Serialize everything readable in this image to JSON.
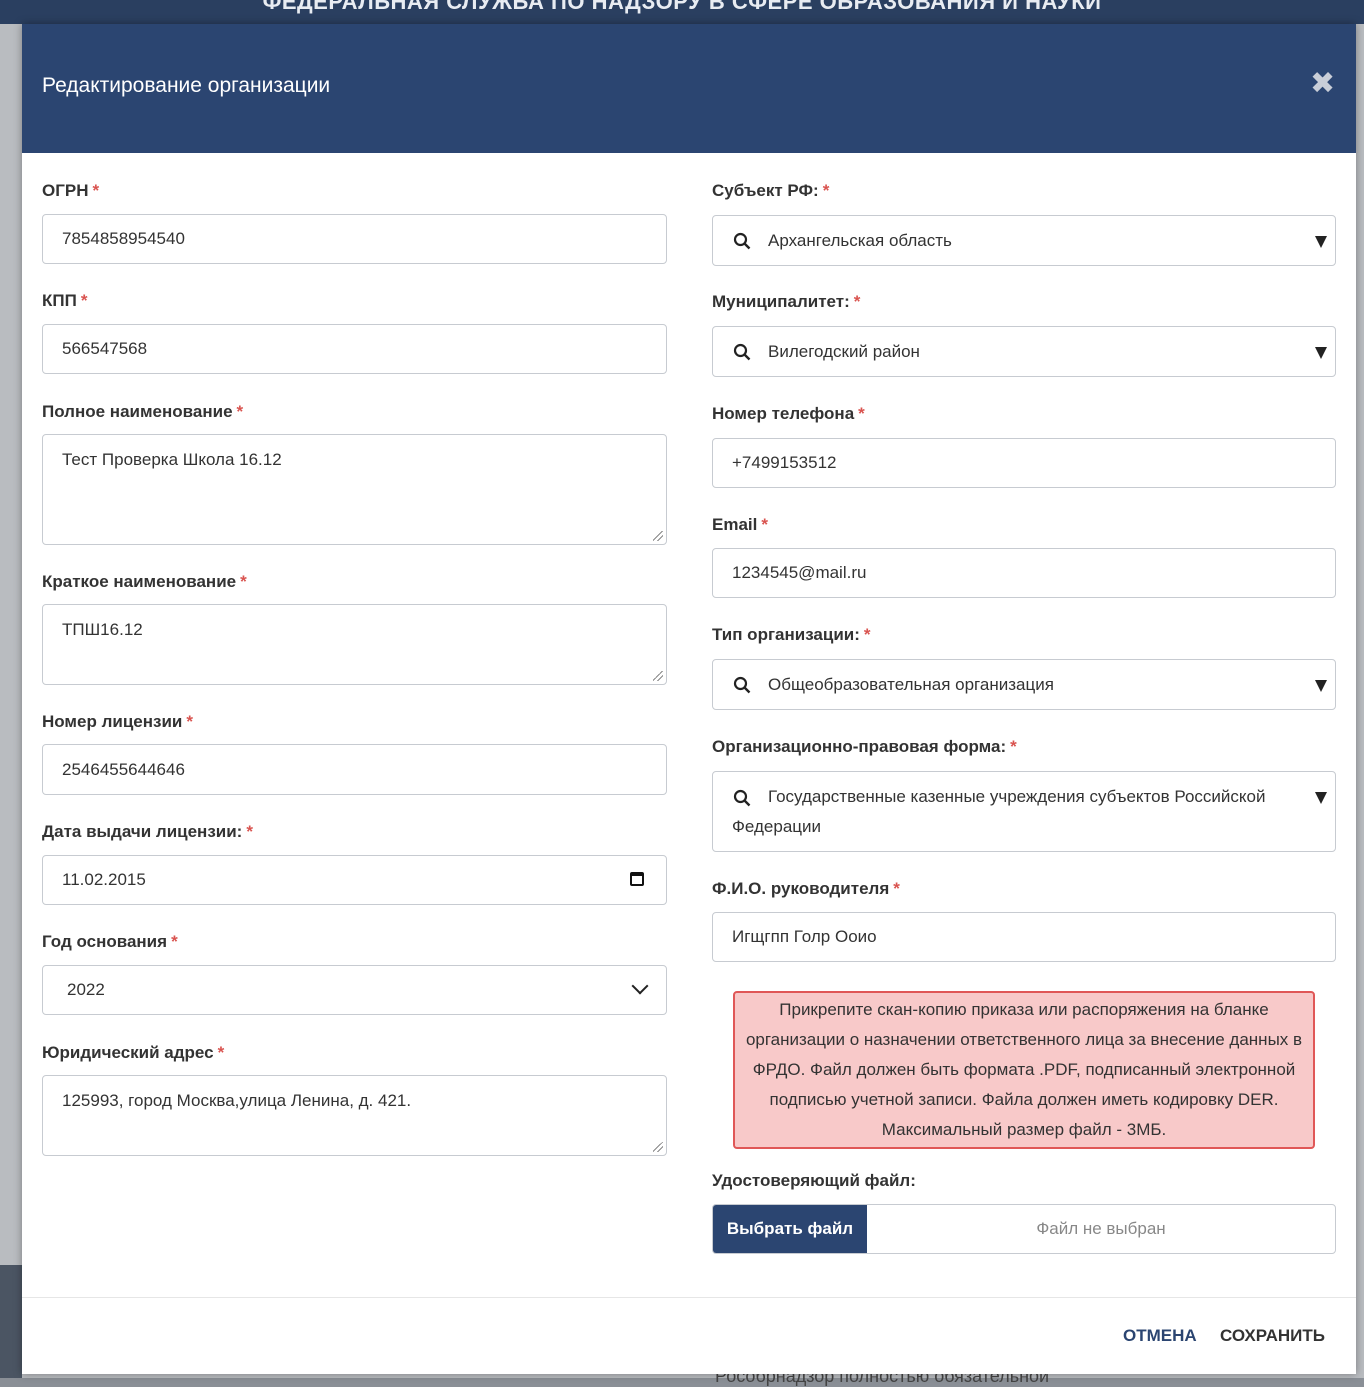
{
  "backdrop": {
    "header_text": "ФЕДЕРАЛЬНАЯ СЛУЖБА ПО НАДЗОРУ В СФЕРЕ ОБРАЗОВАНИЯ И НАУКИ",
    "bottom_text": "Рособрнадзор полностью обязательной"
  },
  "modal": {
    "title": "Редактирование организации",
    "close_icon": "close-icon"
  },
  "form": {
    "ogrn": {
      "label": "ОГРН",
      "value": "7854858954540"
    },
    "kpp": {
      "label": "КПП",
      "value": "566547568"
    },
    "full_name": {
      "label": "Полное наименование",
      "value": "Тест Проверка Школа 16.12"
    },
    "short_name": {
      "label": "Краткое наименование",
      "value": "ТПШ16.12"
    },
    "license_number": {
      "label": "Номер лицензии",
      "value": "2546455644646"
    },
    "license_date": {
      "label": "Дата выдачи лицензии:",
      "value": "11.02.2015"
    },
    "founding_year": {
      "label": "Год основания",
      "value": "2022"
    },
    "legal_address": {
      "label": "Юридический адрес",
      "value": "125993, город Москва,улица Ленина, д. 421."
    },
    "region": {
      "label": "Субъект РФ:",
      "value": "Архангельская область"
    },
    "municipality": {
      "label": "Муниципалитет:",
      "value": "Вилегодский район"
    },
    "phone": {
      "label": "Номер телефона",
      "value": "+7499153512"
    },
    "email": {
      "label": "Email",
      "value": "1234545@mail.ru"
    },
    "org_type": {
      "label": "Тип организации:",
      "value": "Общеобразовательная организация"
    },
    "legal_form": {
      "label": "Организационно-правовая форма:",
      "value": "Государственные казенные учреждения субъектов Российской Федерации"
    },
    "director": {
      "label": "Ф.И.О. руководителя",
      "value": "Игщгпп Голр Ооио"
    },
    "required_mark": "*"
  },
  "alert": {
    "text": "Прикрепите скан-копию приказа или распоряжения на бланке организации о назначении ответственного лица за внесение данных в ФРДО. Файл должен быть формата .PDF, подписанный электронной подписью учетной записи. Файла должен иметь кодировку DER. Максимальный размер файл - 3МБ."
  },
  "file": {
    "label": "Удостоверяющий файл:",
    "button": "Выбрать файл",
    "status": "Файл не выбран"
  },
  "footer": {
    "cancel": "ОТМЕНА",
    "save": "СОХРАНИТЬ"
  },
  "colors": {
    "header_bg": "#2b4571",
    "required": "#d9534f",
    "alert_bg": "#f8c9c9",
    "alert_border": "#e05757"
  }
}
